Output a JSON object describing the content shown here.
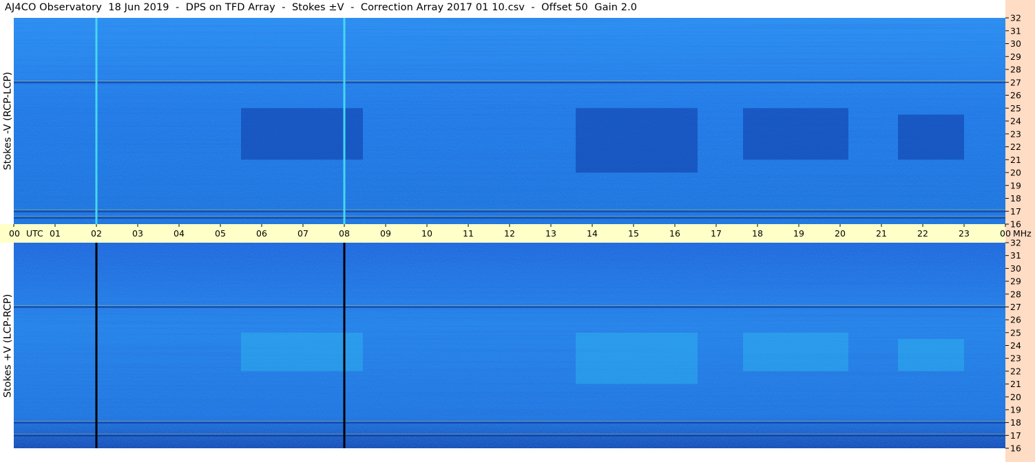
{
  "title": "AJ4CO Observatory  18 Jun 2019  -  DPS on TFD Array  -  Stokes ±V  -  Correction Array 2017 01 10.csv  -  Offset 50  Gain 2.0",
  "colors": {
    "background": "#ffffff",
    "time_band": "#ffffc8",
    "freq_band": "#ffdcc4",
    "field_base": "#1e78e6",
    "field_dark": "#0a2c9a",
    "field_light": "#32c8f0",
    "rfi_yellow": "#e8f050"
  },
  "chart_data": [
    {
      "type": "heatmap",
      "name": "top-panel",
      "ylabel": "Stokes -V (RCP-LCP)",
      "x_range_utc_hours": [
        0,
        24
      ],
      "y_range_mhz": [
        16,
        32
      ],
      "yticks": [
        "32",
        "31",
        "30",
        "29",
        "28",
        "27",
        "26",
        "25",
        "24",
        "23",
        "22",
        "21",
        "20",
        "19",
        "18",
        "17",
        "16"
      ],
      "vertical_lines_utc": [
        2.0,
        8.0
      ],
      "vertical_line_color": "#44d8f0",
      "dark_regions": [
        {
          "x0": 5.5,
          "x1": 8.45,
          "y0": 21,
          "y1": 25
        },
        {
          "x0": 13.6,
          "x1": 16.55,
          "y0": 20,
          "y1": 25
        },
        {
          "x0": 17.65,
          "x1": 20.2,
          "y0": 21,
          "y1": 25
        },
        {
          "x0": 21.4,
          "x1": 23.0,
          "y0": 21,
          "y1": 24.5
        }
      ],
      "rfi_bands_mhz": [
        27,
        17,
        16.5
      ],
      "grid": false
    },
    {
      "type": "heatmap",
      "name": "bottom-panel",
      "ylabel": "Stokes +V (LCP-RCP)",
      "x_range_utc_hours": [
        0,
        24
      ],
      "y_range_mhz": [
        16,
        32
      ],
      "yticks": [
        "32",
        "31",
        "30",
        "29",
        "28",
        "27",
        "26",
        "25",
        "24",
        "23",
        "22",
        "21",
        "20",
        "19",
        "18",
        "17",
        "16"
      ],
      "vertical_lines_utc": [
        2.0,
        8.0
      ],
      "vertical_line_color": "#000000",
      "light_regions": [
        {
          "x0": 5.5,
          "x1": 8.45,
          "y0": 22,
          "y1": 25
        },
        {
          "x0": 13.6,
          "x1": 16.55,
          "y0": 21,
          "y1": 25
        },
        {
          "x0": 17.65,
          "x1": 20.2,
          "y0": 22,
          "y1": 25
        },
        {
          "x0": 21.4,
          "x1": 23.0,
          "y0": 22,
          "y1": 24.5
        }
      ],
      "rfi_bands_mhz": [
        27,
        18,
        17
      ],
      "grid": false
    }
  ],
  "time_axis": {
    "labels": [
      "00",
      "UTC",
      "01",
      "02",
      "03",
      "04",
      "05",
      "06",
      "07",
      "08",
      "09",
      "10",
      "11",
      "12",
      "13",
      "14",
      "15",
      "16",
      "17",
      "18",
      "19",
      "20",
      "21",
      "22",
      "23",
      "00",
      "MHz"
    ]
  }
}
